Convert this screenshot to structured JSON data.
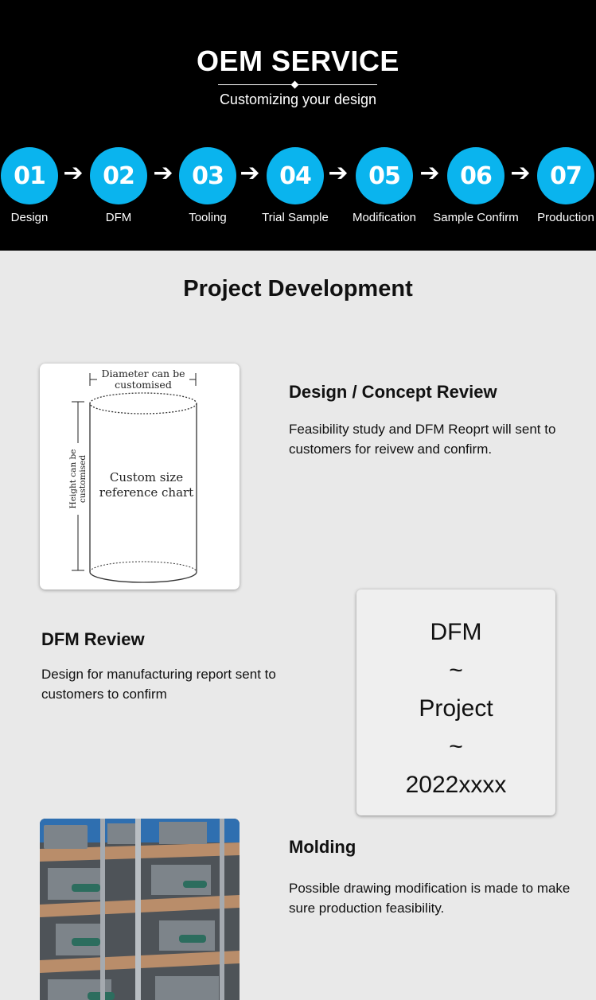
{
  "oem": {
    "title": "OEM SERVICE",
    "subtitle": "Customizing your design",
    "accent_color": "#0ab4ee",
    "steps": [
      {
        "number": "01",
        "label": "Design"
      },
      {
        "number": "02",
        "label": "DFM"
      },
      {
        "number": "03",
        "label": "Tooling"
      },
      {
        "number": "04",
        "label": "Trial Sample"
      },
      {
        "number": "05",
        "label": "Modification"
      },
      {
        "number": "06",
        "label": "Sample Confirm"
      },
      {
        "number": "07",
        "label": "Production"
      }
    ],
    "arrow_icon": "arrow-right-icon"
  },
  "project": {
    "title": "Project Development",
    "chart": {
      "diameter_label_1": "Diameter can be",
      "diameter_label_2": "customised",
      "height_label_1": "Height can be",
      "height_label_2": "customised",
      "center_line_1": "Custom size",
      "center_line_2": "reference chart"
    },
    "design": {
      "title": "Design / Concept Review",
      "text": "Feasibility study and DFM Reoprt will sent to customers for reivew and confirm."
    },
    "dfm": {
      "title": "DFM Review",
      "text": "Design for manufacturing report sent to customers to confirm",
      "box_lines": [
        "DFM",
        "~",
        "Project",
        "~",
        "2022xxxx"
      ]
    },
    "molding": {
      "title": "Molding",
      "text": "Possible drawing modification is made to make sure production feasibility."
    }
  }
}
